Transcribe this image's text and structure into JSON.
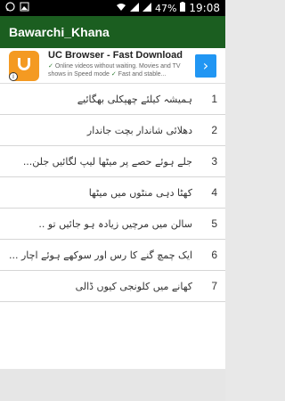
{
  "statusbar": {
    "time": "19:08",
    "battery": "47%",
    "icons": [
      "whatsapp-icon",
      "image-icon",
      "wifi-icon",
      "signal-icon",
      "signal-icon",
      "battery-icon"
    ]
  },
  "app": {
    "title": "Bawarchi_Khana",
    "bar_color": "#1b5e20"
  },
  "ad": {
    "title": "UC Browser - Fast Download",
    "desc_line1": "Online videos without waiting. Movies and TV",
    "desc_line2": "shows in Speed mode",
    "desc_line3": "Fast and stable...",
    "badge": "i",
    "arrow": "›"
  },
  "items": [
    {
      "num": "1",
      "text": "ہمیشہ کیلئے چھپکلی بھگائیے"
    },
    {
      "num": "2",
      "text": "دھلائی شاندار بچت جاندار"
    },
    {
      "num": "3",
      "text": "جلے ہوئے حصے پر میٹھا لیپ لگائیں جلن..."
    },
    {
      "num": "4",
      "text": "کھٹا دہی منٹوں میں میٹھا"
    },
    {
      "num": "5",
      "text": "سالن میں مرچیں زیادہ ہو جائیں تو .."
    },
    {
      "num": "6",
      "text": "ایک چمچ گنے کا رس اور سوکھے ہوئے اچار ..."
    },
    {
      "num": "7",
      "text": "کھانے میں کلونجی کیوں ڈالی"
    }
  ]
}
